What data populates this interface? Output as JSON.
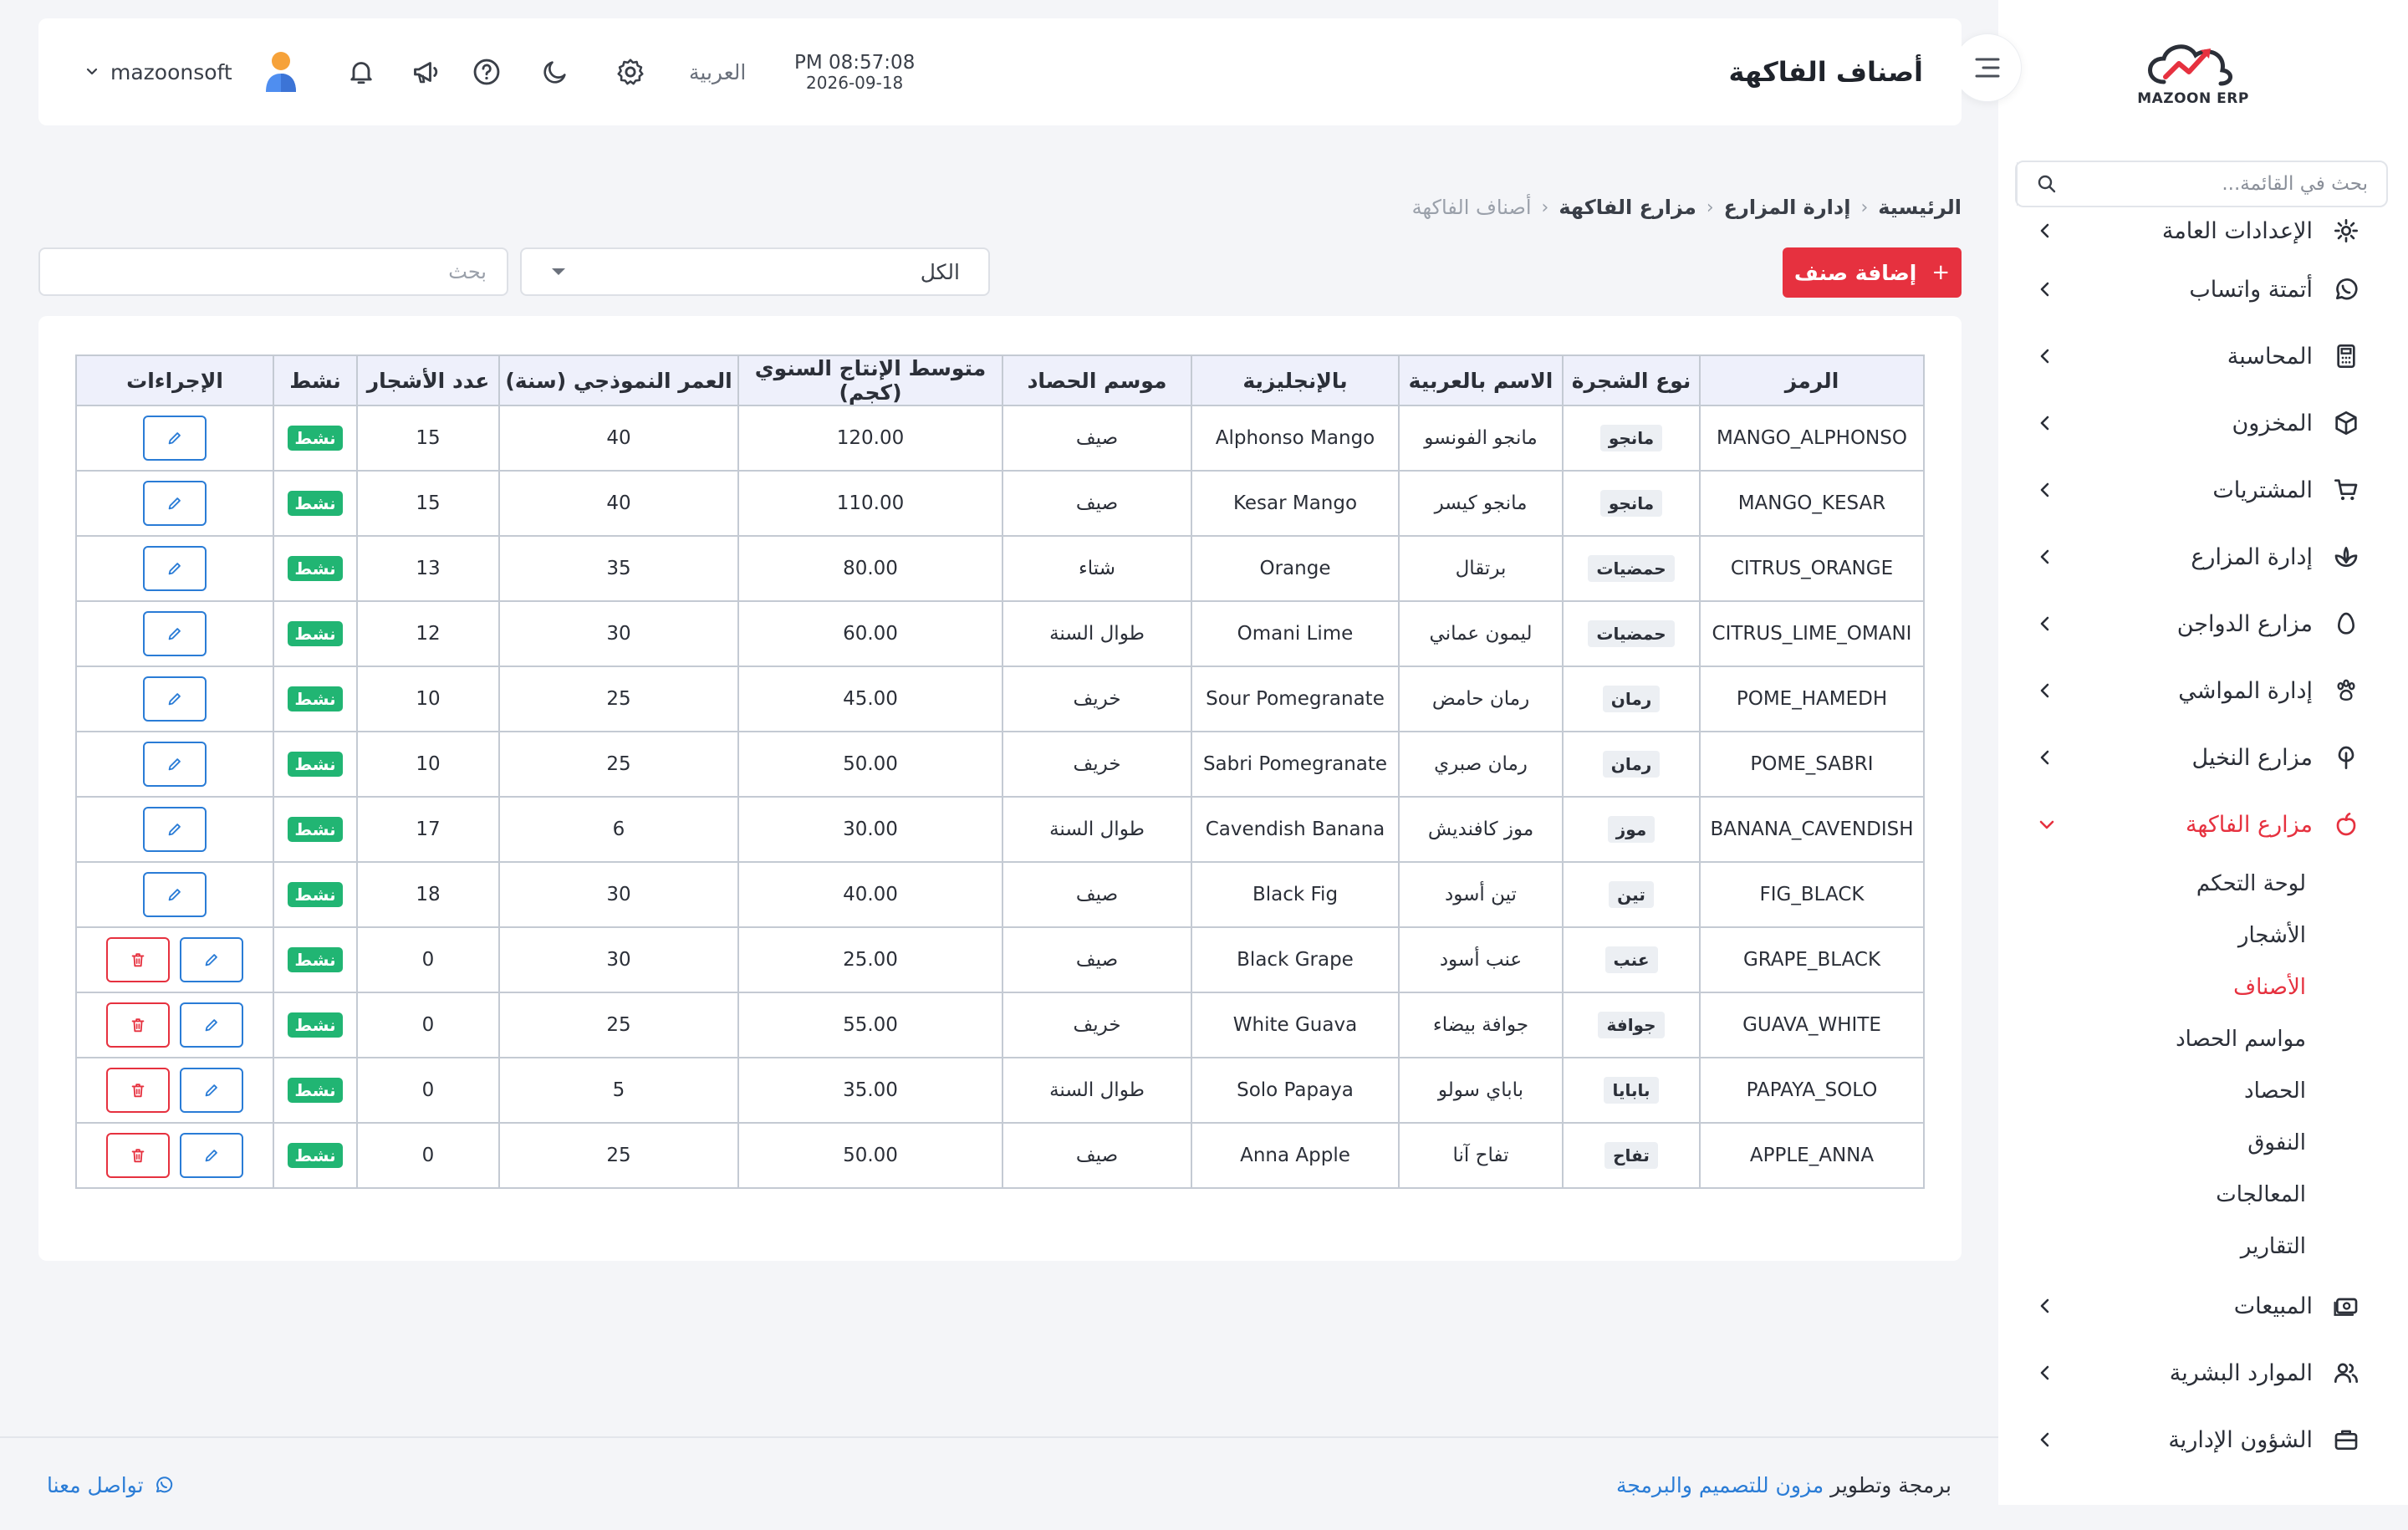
{
  "brand": {
    "logo_text": "MAZOON ERP",
    "accent": "#e6313f",
    "link": "#21a7d8"
  },
  "header": {
    "title": "أصناف الفاكهة",
    "time": "PM 08:57:08",
    "date": "2026-09-18",
    "language": "العربية",
    "username": "mazoonsoft",
    "icons": [
      "settings-icon",
      "moon-icon",
      "help-icon",
      "megaphone-icon",
      "bell-icon",
      "avatar"
    ]
  },
  "sidebar": {
    "search_placeholder": "بحث في القائمة...",
    "items": [
      {
        "label": "الإعدادات العامة",
        "icon": "gear-icon"
      },
      {
        "label": "أتمتة واتساب",
        "icon": "whatsapp-icon"
      },
      {
        "label": "المحاسبة",
        "icon": "calculator-icon"
      },
      {
        "label": "المخزون",
        "icon": "box-icon"
      },
      {
        "label": "المشتريات",
        "icon": "cart-icon"
      },
      {
        "label": "إدارة المزارع",
        "icon": "plant-icon"
      },
      {
        "label": "مزارع الدواجن",
        "icon": "egg-icon"
      },
      {
        "label": "إدارة المواشي",
        "icon": "paw-icon"
      },
      {
        "label": "مزارع النخيل",
        "icon": "palm-icon"
      },
      {
        "label": "مزارع الفاكهة",
        "icon": "fruit-icon"
      },
      {
        "label": "المبيعات",
        "icon": "cash-icon"
      },
      {
        "label": "الموارد البشرية",
        "icon": "users-icon"
      },
      {
        "label": "الشؤون الإدارية",
        "icon": "briefcase-icon"
      }
    ],
    "submenu": [
      "لوحة التحكم",
      "الأشجار",
      "الأصناف",
      "مواسم الحصاد",
      "الحصاد",
      "النفوق",
      "المعالجات",
      "التقارير"
    ]
  },
  "breadcrumb": [
    "الرئيسية",
    "إدارة المزارع",
    "مزارع الفاكهة",
    "أصناف الفاكهة"
  ],
  "toolbar": {
    "add_label": "إضافة صنف",
    "filter_value": "الكل",
    "search_placeholder": "بحث"
  },
  "table": {
    "headers": [
      "الرمز",
      "نوع الشجرة",
      "الاسم بالعربية",
      "بالإنجليزية",
      "موسم الحصاد",
      "متوسط الإنتاج السنوي (كجم)",
      "العمر النموذجي (سنة)",
      "عدد الأشجار",
      "نشط",
      "الإجراءات"
    ],
    "rows": [
      {
        "code": "MANGO_ALPHONSO",
        "type": "مانجو",
        "name_ar": "مانجو الفونسو",
        "name_en": "Alphonso Mango",
        "season": "صيف",
        "yield": "120.00",
        "age": "40",
        "trees": "15",
        "status": "نشط",
        "deletable": false
      },
      {
        "code": "MANGO_KESAR",
        "type": "مانجو",
        "name_ar": "مانجو كيسر",
        "name_en": "Kesar Mango",
        "season": "صيف",
        "yield": "110.00",
        "age": "40",
        "trees": "15",
        "status": "نشط",
        "deletable": false
      },
      {
        "code": "CITRUS_ORANGE",
        "type": "حمضيات",
        "name_ar": "برتقال",
        "name_en": "Orange",
        "season": "شتاء",
        "yield": "80.00",
        "age": "35",
        "trees": "13",
        "status": "نشط",
        "deletable": false
      },
      {
        "code": "CITRUS_LIME_OMANI",
        "type": "حمضيات",
        "name_ar": "ليمون عماني",
        "name_en": "Omani Lime",
        "season": "طوال السنة",
        "yield": "60.00",
        "age": "30",
        "trees": "12",
        "status": "نشط",
        "deletable": false
      },
      {
        "code": "POME_HAMEDH",
        "type": "رمان",
        "name_ar": "رمان حامض",
        "name_en": "Sour Pomegranate",
        "season": "خريف",
        "yield": "45.00",
        "age": "25",
        "trees": "10",
        "status": "نشط",
        "deletable": false
      },
      {
        "code": "POME_SABRI",
        "type": "رمان",
        "name_ar": "رمان صبري",
        "name_en": "Sabri Pomegranate",
        "season": "خريف",
        "yield": "50.00",
        "age": "25",
        "trees": "10",
        "status": "نشط",
        "deletable": false
      },
      {
        "code": "BANANA_CAVENDISH",
        "type": "موز",
        "name_ar": "موز كافنديش",
        "name_en": "Cavendish Banana",
        "season": "طوال السنة",
        "yield": "30.00",
        "age": "6",
        "trees": "17",
        "status": "نشط",
        "deletable": false
      },
      {
        "code": "FIG_BLACK",
        "type": "تين",
        "name_ar": "تين أسود",
        "name_en": "Black Fig",
        "season": "صيف",
        "yield": "40.00",
        "age": "30",
        "trees": "18",
        "status": "نشط",
        "deletable": false
      },
      {
        "code": "GRAPE_BLACK",
        "type": "عنب",
        "name_ar": "عنب أسود",
        "name_en": "Black Grape",
        "season": "صيف",
        "yield": "25.00",
        "age": "30",
        "trees": "0",
        "status": "نشط",
        "deletable": true
      },
      {
        "code": "GUAVA_WHITE",
        "type": "جوافة",
        "name_ar": "جوافة بيضاء",
        "name_en": "White Guava",
        "season": "خريف",
        "yield": "55.00",
        "age": "25",
        "trees": "0",
        "status": "نشط",
        "deletable": true
      },
      {
        "code": "PAPAYA_SOLO",
        "type": "بابايا",
        "name_ar": "باباي سولو",
        "name_en": "Solo Papaya",
        "season": "طوال السنة",
        "yield": "35.00",
        "age": "5",
        "trees": "0",
        "status": "نشط",
        "deletable": true
      },
      {
        "code": "APPLE_ANNA",
        "type": "تفاح",
        "name_ar": "تفاح آنا",
        "name_en": "Anna Apple",
        "season": "صيف",
        "yield": "50.00",
        "age": "25",
        "trees": "0",
        "status": "نشط",
        "deletable": true
      }
    ]
  },
  "footer": {
    "credit_prefix": "برمجة وتطوير",
    "company": "مزون للتصميم والبرمجة",
    "contact": "تواصل معنا"
  }
}
